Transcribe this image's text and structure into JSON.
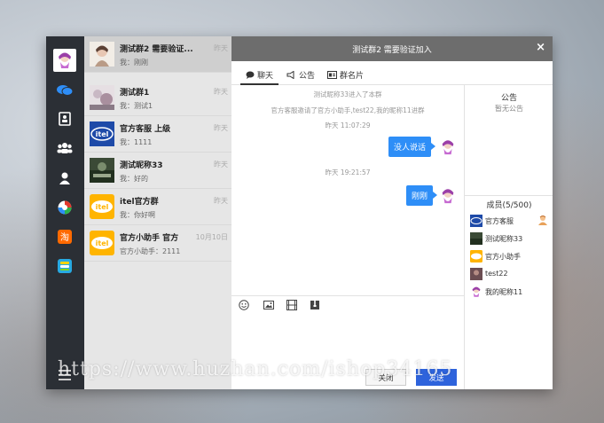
{
  "window": {
    "title": "测试群2 需要验证加入",
    "close_glyph": "×"
  },
  "tabs": [
    {
      "label": "聊天",
      "active": true
    },
    {
      "label": "公告",
      "active": false
    },
    {
      "label": "群名片",
      "active": false
    }
  ],
  "conversations": [
    {
      "name": "测试群2 需要验证...",
      "time": "昨天",
      "snippet": "我：刚刚",
      "active": true
    },
    {
      "name": "测试群1",
      "time": "昨天",
      "snippet": "我：测试1",
      "active": false
    },
    {
      "name": "官方客服 上级",
      "time": "昨天",
      "snippet": "我：1111",
      "active": false
    },
    {
      "name": "测试昵称33",
      "time": "昨天",
      "snippet": "我：好的",
      "active": false
    },
    {
      "name": "itel官方群",
      "time": "昨天",
      "snippet": "我：你好啊",
      "active": false
    },
    {
      "name": "官方小助手 官方",
      "time": "10月10日",
      "snippet": "官方小助手：2111",
      "active": false
    }
  ],
  "messages": {
    "sys1": "测试昵称33进入了本群",
    "sys2": "官方客服邀请了官方小助手,test22,我的昵称11进群",
    "time1": "昨天 11:07:29",
    "bubble1": "没人说话",
    "time2": "昨天 19:21:57",
    "bubble2": "刚刚"
  },
  "sidebar": {
    "notice_title": "公告",
    "notice_text": "暂无公告",
    "members_title": "成员(5/500)",
    "members": [
      {
        "name": "官方客服",
        "owner": true
      },
      {
        "name": "测试昵称33",
        "owner": false
      },
      {
        "name": "官方小助手",
        "owner": false
      },
      {
        "name": "test22",
        "owner": false
      },
      {
        "name": "我的昵称11",
        "owner": false
      }
    ]
  },
  "buttons": {
    "close_label": "关闭",
    "send_label": "发送"
  },
  "watermark": "https://www.huzhan.com/ishop34165",
  "colors": {
    "accent": "#2e8ef7",
    "send": "#2e63dc",
    "rail": "#2b2f35",
    "titlebar": "#6d6d6d"
  }
}
